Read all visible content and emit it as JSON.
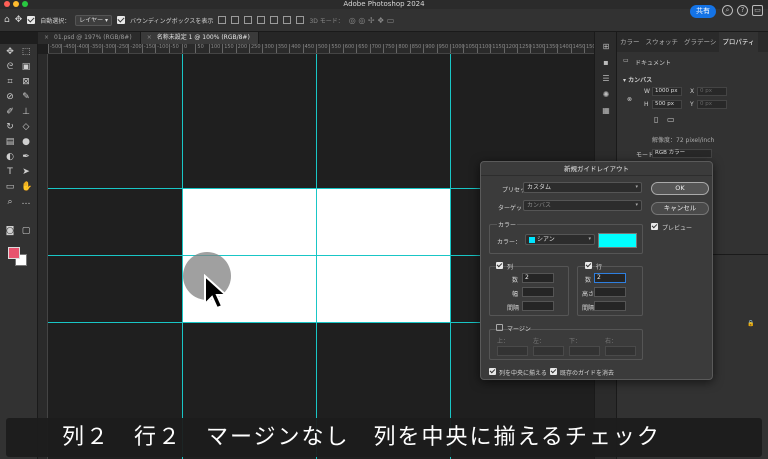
{
  "app": {
    "title": "Adobe Photoshop 2024"
  },
  "options_bar": {
    "auto_select_label": "自動選択：",
    "layer_select": "レイヤー",
    "bbox_label": "バウンディングボックスを表示",
    "mode_3d": "3D モード：",
    "share_label": "共有"
  },
  "tabs": [
    {
      "label": "01.psd @ 197% (RGB/8#)",
      "active": false
    },
    {
      "label": "名称未設定 1 @ 100% (RGB/8#)",
      "active": true
    }
  ],
  "ruler": {
    "h_ticks": [
      "-550",
      "-500",
      "-450",
      "-400",
      "-350",
      "-300",
      "-250",
      "-200",
      "-150",
      "-100",
      "-50",
      "0",
      "50",
      "100",
      "150",
      "200",
      "250",
      "300",
      "350",
      "400",
      "450",
      "500",
      "550",
      "600",
      "650",
      "700",
      "750",
      "800",
      "850",
      "900",
      "950",
      "1000",
      "1050",
      "1100",
      "1150",
      "1200",
      "1250",
      "1300",
      "1350",
      "1400",
      "1450",
      "1500",
      "1550"
    ]
  },
  "right_panel": {
    "tabs": [
      "カラー",
      "スウォッチ",
      "グラデーシ",
      "プロパティ"
    ],
    "doc_label": "ドキュメント",
    "canvas_section": "カンバス",
    "w_label": "W",
    "w_value": "1000 px",
    "h_label": "H",
    "h_value": "500 px",
    "x_label": "X",
    "x_value": "0 px",
    "y_label": "Y",
    "y_value": "0 px",
    "resolution": "解像度：72 pixel/inch",
    "mode_label": "モード",
    "mode_value": "RGB カラー"
  },
  "dialog": {
    "title": "新規ガイドレイアウト",
    "preset_label": "プリセット：",
    "preset_value": "カスタム",
    "target_label": "ターゲット：",
    "target_value": "カンバス",
    "color_group": "カラー",
    "color_label": "カラー：",
    "color_value": "シアン",
    "color_hex": "#00ffff",
    "ok": "OK",
    "cancel": "キャンセル",
    "preview": "プレビュー",
    "columns_label": "列",
    "rows_label": "行",
    "number_label": "数",
    "width_label": "幅",
    "height_label": "高さ",
    "gutter_label": "間隔",
    "columns_number": "2",
    "rows_number": "2",
    "margin_label": "マージン",
    "margin_top": "上：",
    "margin_left": "左：",
    "margin_bottom": "下：",
    "margin_right": "右：",
    "center_columns": "列を中央に揃える",
    "clear_existing": "既存のガイドを消去"
  },
  "caption": "列２　行２　マージンなし　列を中央に揃えるチェック"
}
